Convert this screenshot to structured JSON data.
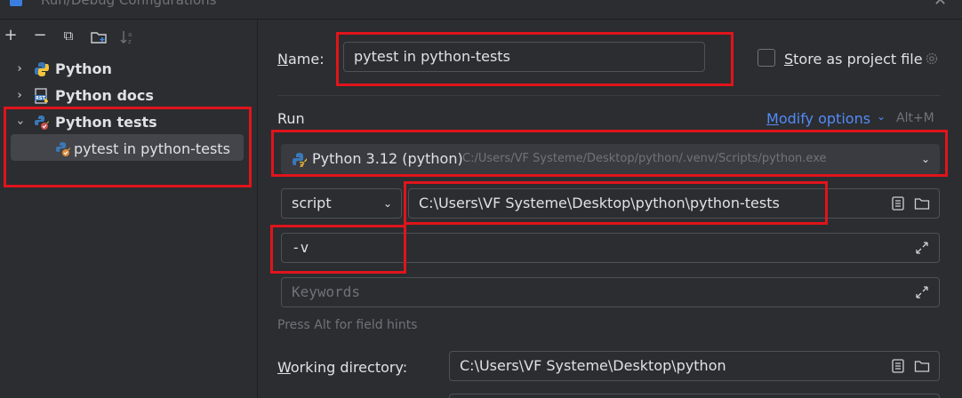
{
  "window": {
    "title": "Run/Debug Configurations",
    "close_glyph": "✕"
  },
  "toolbar": {
    "add": "+",
    "remove": "−",
    "copy": "⧉",
    "new_folder": "▢",
    "sort": "↓"
  },
  "tree": {
    "items": [
      {
        "label": "Python",
        "icon": "python-icon",
        "expanded": false
      },
      {
        "label": "Python docs",
        "icon": "rst-docs-icon",
        "expanded": false
      },
      {
        "label": "Python tests",
        "icon": "python-tests-icon",
        "expanded": true
      },
      {
        "label": "pytest in python-tests",
        "icon": "pytest-icon",
        "selected": true
      }
    ]
  },
  "form": {
    "name_label_u": "N",
    "name_label_rest": "ame:",
    "name_value": "pytest in python-tests",
    "store_label_u": "S",
    "store_label_rest": "tore as project file",
    "run_section": "Run",
    "modify_options_u": "M",
    "modify_options_rest": "odify options",
    "modify_shortcut": "Alt+M",
    "interpreter_name": "Python 3.12 (python)",
    "interpreter_path": "C:/Users/VF Systeme/Desktop/python/.venv/Scripts/python.exe",
    "target_type": "script",
    "target_path": "C:\\Users\\VF Systeme\\Desktop\\python\\python-tests",
    "additional_args": "-v",
    "keywords_placeholder": "Keywords",
    "field_hint": "Press Alt for field hints",
    "working_dir_label_u": "W",
    "working_dir_label_rest": "orking directory:",
    "working_dir_value": "C:\\Users\\VF Systeme\\Desktop\\python"
  },
  "colors": {
    "accent_link": "#548af7",
    "annotation_red": "#e0141c",
    "background": "#2b2d30"
  }
}
